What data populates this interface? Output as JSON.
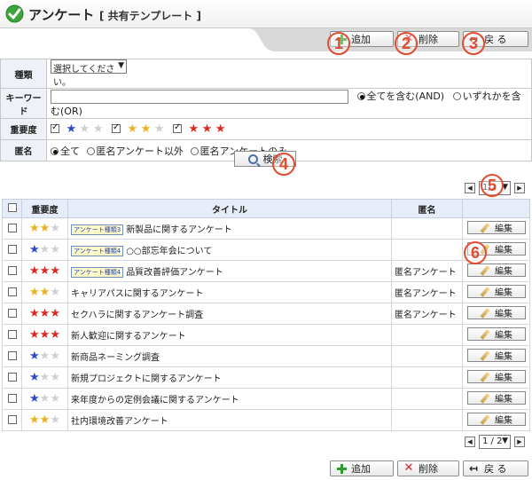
{
  "header": {
    "title": "アンケート",
    "subtitle": "[ 共有テンプレート ]"
  },
  "toolbar": {
    "add_label": "追加",
    "delete_label": "削除",
    "back_label": "戻 る"
  },
  "markers": [
    "1",
    "2",
    "3",
    "4",
    "5",
    "6"
  ],
  "filter": {
    "type_label": "種類",
    "type_select": "選択してください。",
    "keyword_label": "キーワード",
    "keyword_value": "",
    "match_all": "全てを含む(AND)",
    "match_any": "いずれかを含む(OR)",
    "importance_label": "重要度",
    "anon_label": "匿名",
    "anon_all": "全て",
    "anon_except": "匿名アンケート以外",
    "anon_only": "匿名アンケートのみ"
  },
  "search": {
    "label": "検索"
  },
  "pager": {
    "top_value": "1/2",
    "bottom_value": "1 / 2"
  },
  "table": {
    "headers": {
      "importance": "重要度",
      "title": "タイトル",
      "anonymous": "匿名"
    },
    "edit_label": "編集",
    "rows": [
      {
        "importance": "2",
        "tag": "アンケート種類3",
        "title": "新製品に関するアンケート",
        "anonymous": ""
      },
      {
        "importance": "1",
        "tag": "アンケート種類4",
        "title": "○○部忘年会について",
        "anonymous": ""
      },
      {
        "importance": "3",
        "tag": "アンケート種類4",
        "title": "品質改善評価アンケート",
        "anonymous": "匿名アンケート"
      },
      {
        "importance": "2",
        "tag": "",
        "title": "キャリアパスに関するアンケート",
        "anonymous": "匿名アンケート"
      },
      {
        "importance": "3",
        "tag": "",
        "title": "セクハラに関するアンケート調査",
        "anonymous": "匿名アンケート"
      },
      {
        "importance": "3",
        "tag": "",
        "title": "新人歓迎に関するアンケート",
        "anonymous": ""
      },
      {
        "importance": "1",
        "tag": "",
        "title": "新商品ネーミング調査",
        "anonymous": ""
      },
      {
        "importance": "1",
        "tag": "",
        "title": "新規プロジェクトに関するアンケート",
        "anonymous": ""
      },
      {
        "importance": "1",
        "tag": "",
        "title": "来年度からの定例会議に関するアンケート",
        "anonymous": ""
      },
      {
        "importance": "2",
        "tag": "",
        "title": "社内環境改善アンケート",
        "anonymous": ""
      }
    ]
  },
  "colors": {
    "accent": "#e34b2e",
    "header_bg": "#e6edf8",
    "star_blue": "#2b48c8",
    "star_yellow": "#efb020",
    "star_red": "#e02a20"
  }
}
